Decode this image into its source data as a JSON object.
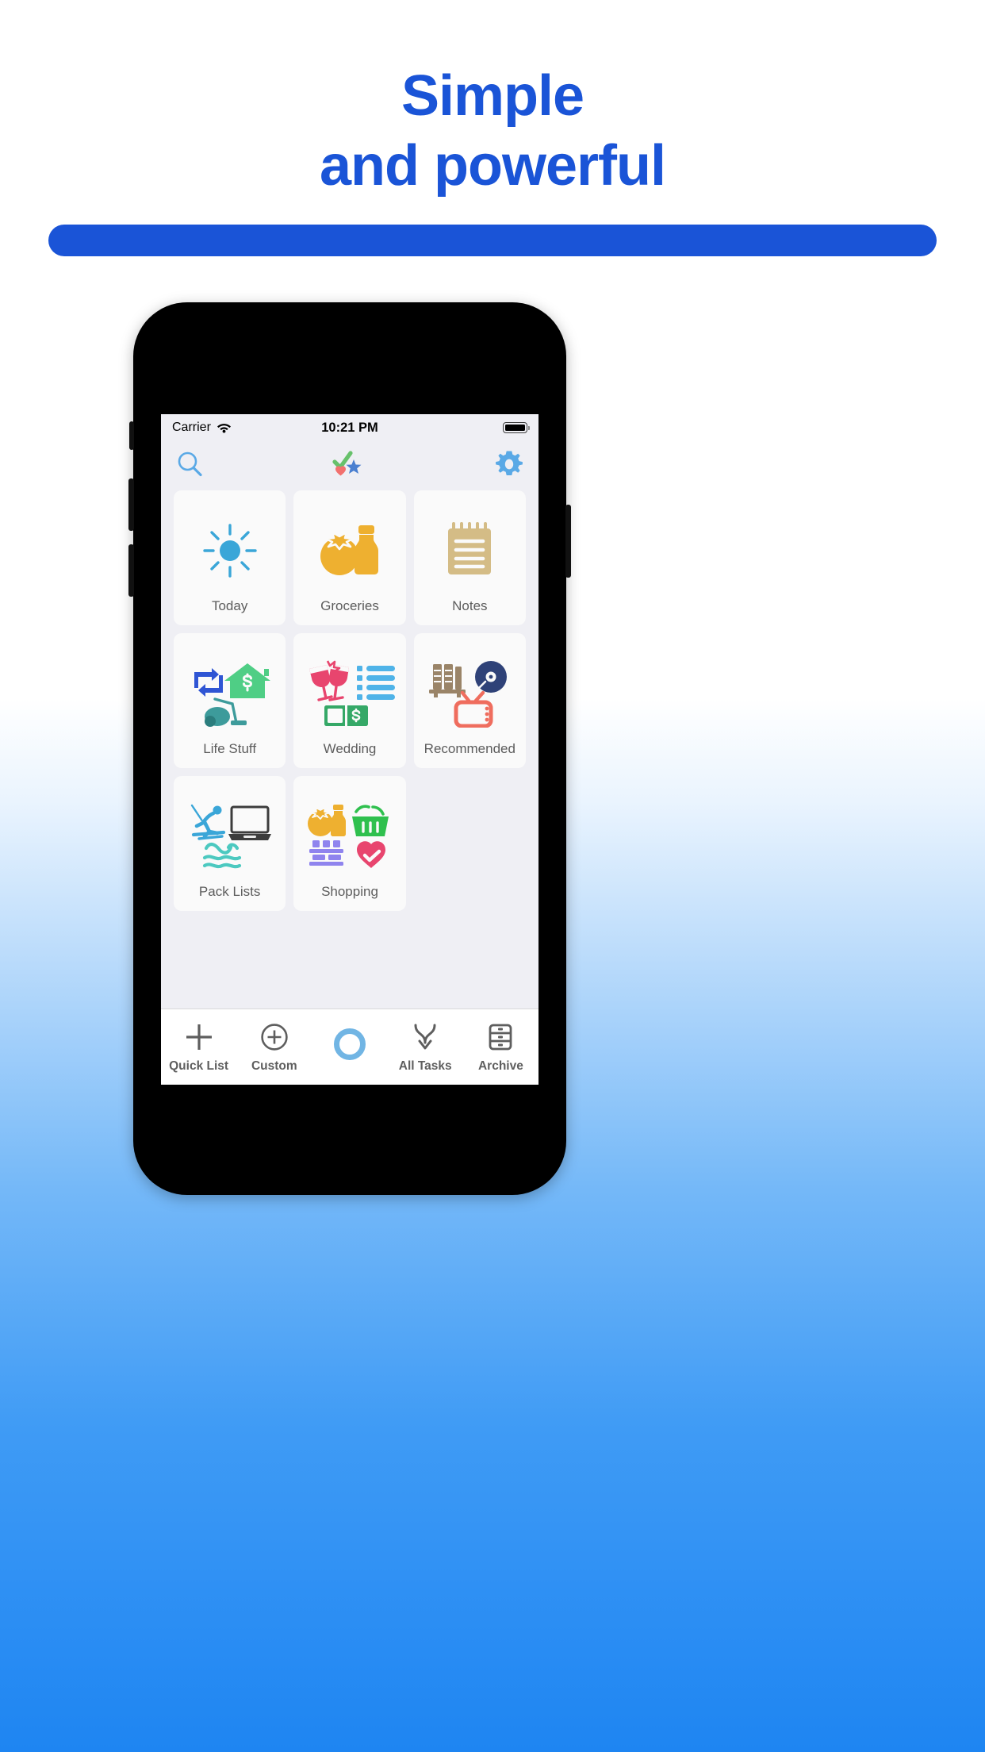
{
  "headline": {
    "line1": "Simple",
    "line2": "and powerful",
    "color": "#1a54d7"
  },
  "pill": {
    "color": "#1a54d7"
  },
  "phone": {
    "statusbar": {
      "carrier": "Carrier",
      "wifi_icon": "wifi-icon",
      "time": "10:21 PM",
      "battery_icon": "battery-full-icon"
    },
    "toolbar": {
      "search_icon": "search-icon",
      "favorites_icon": "check-star-heart-icon",
      "settings_icon": "gear-icon"
    },
    "grid": {
      "tiles": [
        {
          "label": "Today",
          "icons": [
            "sun-icon"
          ]
        },
        {
          "label": "Groceries",
          "icons": [
            "tomato-icon",
            "bottle-icon"
          ]
        },
        {
          "label": "Notes",
          "icons": [
            "notepad-icon"
          ]
        },
        {
          "label": "Life Stuff",
          "icons": [
            "repeat-icon",
            "house-dollar-icon",
            "vacuum-icon"
          ]
        },
        {
          "label": "Wedding",
          "icons": [
            "cheers-glasses-icon",
            "checklist-icon",
            "book-dollar-icon"
          ]
        },
        {
          "label": "Recommended",
          "icons": [
            "books-icon",
            "vinyl-record-icon",
            "tv-icon"
          ]
        },
        {
          "label": "Pack Lists",
          "icons": [
            "skier-icon",
            "laptop-icon",
            "waves-icon"
          ]
        },
        {
          "label": "Shopping",
          "icons": [
            "tomato-icon",
            "basket-icon",
            "shelves-icon",
            "heart-check-icon"
          ]
        }
      ]
    },
    "tabbar": {
      "tabs": [
        {
          "label": "Quick List",
          "icon": "plus-icon"
        },
        {
          "label": "Custom",
          "icon": "circle-plus-icon"
        },
        {
          "label": "",
          "icon": "circle-ring-icon"
        },
        {
          "label": "All Tasks",
          "icon": "merge-arrow-down-icon"
        },
        {
          "label": "Archive",
          "icon": "file-drawers-icon"
        }
      ]
    }
  },
  "colors": {
    "accent_blue": "#1a54d7",
    "ios_blue": "#5aa9e6",
    "sun_blue": "#3aa6d8",
    "orange": "#eeb030",
    "tan": "#d4bc86",
    "green": "#4fce85",
    "teal": "#3d9b9b",
    "pink": "#e8456e",
    "list_blue": "#4fb3e8",
    "brown": "#9a8468",
    "navy": "#2f4278",
    "salmon": "#ef6d5e",
    "purple": "#8f84ee",
    "basket_green": "#2fc04e"
  }
}
